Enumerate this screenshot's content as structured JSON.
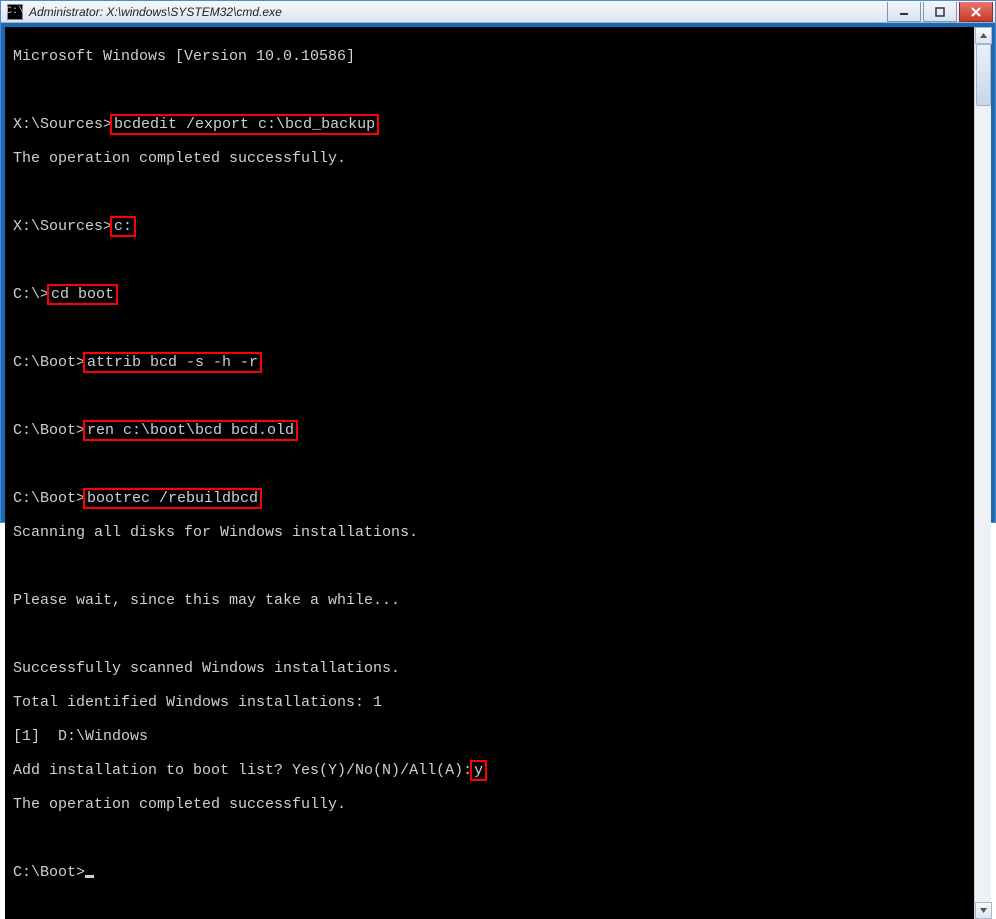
{
  "window": {
    "title": "Administrator: X:\\windows\\SYSTEM32\\cmd.exe",
    "icon_glyph": "C:\\"
  },
  "colors": {
    "highlight_border": "#ff0000",
    "console_bg": "#000000",
    "console_fg": "#cfcfcf"
  },
  "lines": {
    "l1": "Microsoft Windows [Version 10.0.10586]",
    "p1_prompt": "X:\\Sources>",
    "p1_cmd": "bcdedit /export c:\\bcd_backup",
    "r1": "The operation completed successfully.",
    "p2_prompt": "X:\\Sources>",
    "p2_cmd": "c:",
    "p3_prompt": "C:\\>",
    "p3_cmd": "cd boot",
    "p4_prompt": "C:\\Boot>",
    "p4_cmd": "attrib bcd -s -h -r",
    "p5_prompt": "C:\\Boot>",
    "p5_cmd": "ren c:\\boot\\bcd bcd.old",
    "p6_prompt": "C:\\Boot>",
    "p6_cmd": "bootrec /rebuildbcd",
    "r2": "Scanning all disks for Windows installations.",
    "r3": "Please wait, since this may take a while...",
    "r4": "Successfully scanned Windows installations.",
    "r5": "Total identified Windows installations: 1",
    "r6": "[1]  D:\\Windows",
    "q_prompt": "Add installation to boot list? Yes(Y)/No(N)/All(A):",
    "q_answer": "y",
    "r7": "The operation completed successfully.",
    "last_prompt": "C:\\Boot>"
  }
}
